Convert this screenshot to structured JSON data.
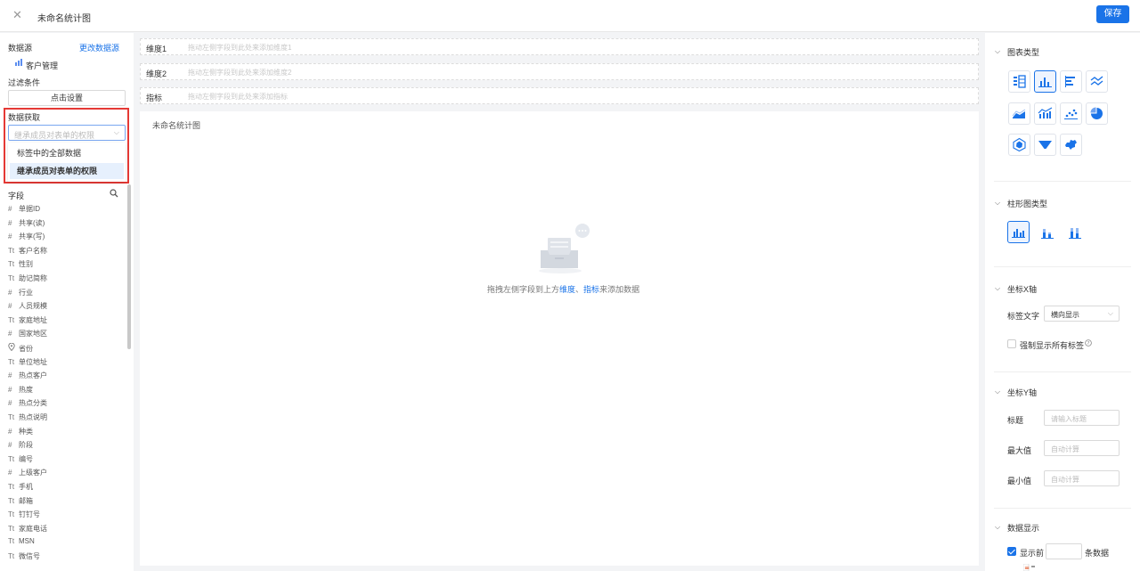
{
  "topbar": {
    "close_icon": "close-icon",
    "title": "未命名统计图",
    "save_label": "保存"
  },
  "left": {
    "datasource_label": "数据源",
    "change_datasource": "更改数据源",
    "datasource_name": "客户管理",
    "filter_label": "过滤条件",
    "filter_button": "点击设置",
    "fetch_label": "数据获取",
    "fetch_select": {
      "placeholder": "继承成员对表单的权限"
    },
    "fetch_options": [
      "标签中的全部数据",
      "继承成员对表单的权限"
    ],
    "fields_label": "字段",
    "fields": [
      {
        "type": "#",
        "name": "单据ID"
      },
      {
        "type": "#",
        "name": "共享(读)"
      },
      {
        "type": "#",
        "name": "共享(写)"
      },
      {
        "type": "Tt",
        "name": "客户名称"
      },
      {
        "type": "Tt",
        "name": "性别"
      },
      {
        "type": "Tt",
        "name": "助记简称"
      },
      {
        "type": "#",
        "name": "行业"
      },
      {
        "type": "#",
        "name": "人员规模"
      },
      {
        "type": "Tt",
        "name": "家庭地址"
      },
      {
        "type": "#",
        "name": "国家地区"
      },
      {
        "type": "pin",
        "name": "省份"
      },
      {
        "type": "Tt",
        "name": "单位地址"
      },
      {
        "type": "#",
        "name": "热点客户"
      },
      {
        "type": "#",
        "name": "热度"
      },
      {
        "type": "#",
        "name": "热点分类"
      },
      {
        "type": "Tt",
        "name": "热点说明"
      },
      {
        "type": "#",
        "name": "种类"
      },
      {
        "type": "#",
        "name": "阶段"
      },
      {
        "type": "Tt",
        "name": "编号"
      },
      {
        "type": "#",
        "name": "上级客户"
      },
      {
        "type": "Tt",
        "name": "手机"
      },
      {
        "type": "Tt",
        "name": "邮箱"
      },
      {
        "type": "Tt",
        "name": "钉钉号"
      },
      {
        "type": "Tt",
        "name": "家庭电话"
      },
      {
        "type": "Tt",
        "name": "MSN"
      },
      {
        "type": "Tt",
        "name": "微信号"
      }
    ]
  },
  "center": {
    "drops": [
      {
        "label": "维度1",
        "hint": "拖动左侧字段到此处来添加维度1"
      },
      {
        "label": "维度2",
        "hint": "拖动左侧字段到此处来添加维度2"
      },
      {
        "label": "指标",
        "hint": "拖动左侧字段到此处来添加指标"
      }
    ],
    "chart_title": "未命名统计图",
    "hint_prefix": "拖拽左侧字段到上方",
    "hint_dim": "维度",
    "hint_sep": "、",
    "hint_metric": "指标",
    "hint_suffix": "来添加数据"
  },
  "right": {
    "chart_type_label": "图表类型",
    "bar_type_label": "柱形图类型",
    "xaxis_label": "坐标X轴",
    "label_text": "标签文字",
    "label_text_value": "横向显示",
    "force_show_labels": "强制显示所有标签",
    "yaxis_label": "坐标Y轴",
    "title_label": "标题",
    "title_placeholder": "请输入标题",
    "max_label": "最大值",
    "max_placeholder": "自动计算",
    "min_label": "最小值",
    "min_placeholder": "自动计算",
    "data_display_label": "数据显示",
    "show_first": "显示前",
    "show_unit": "条数据"
  }
}
